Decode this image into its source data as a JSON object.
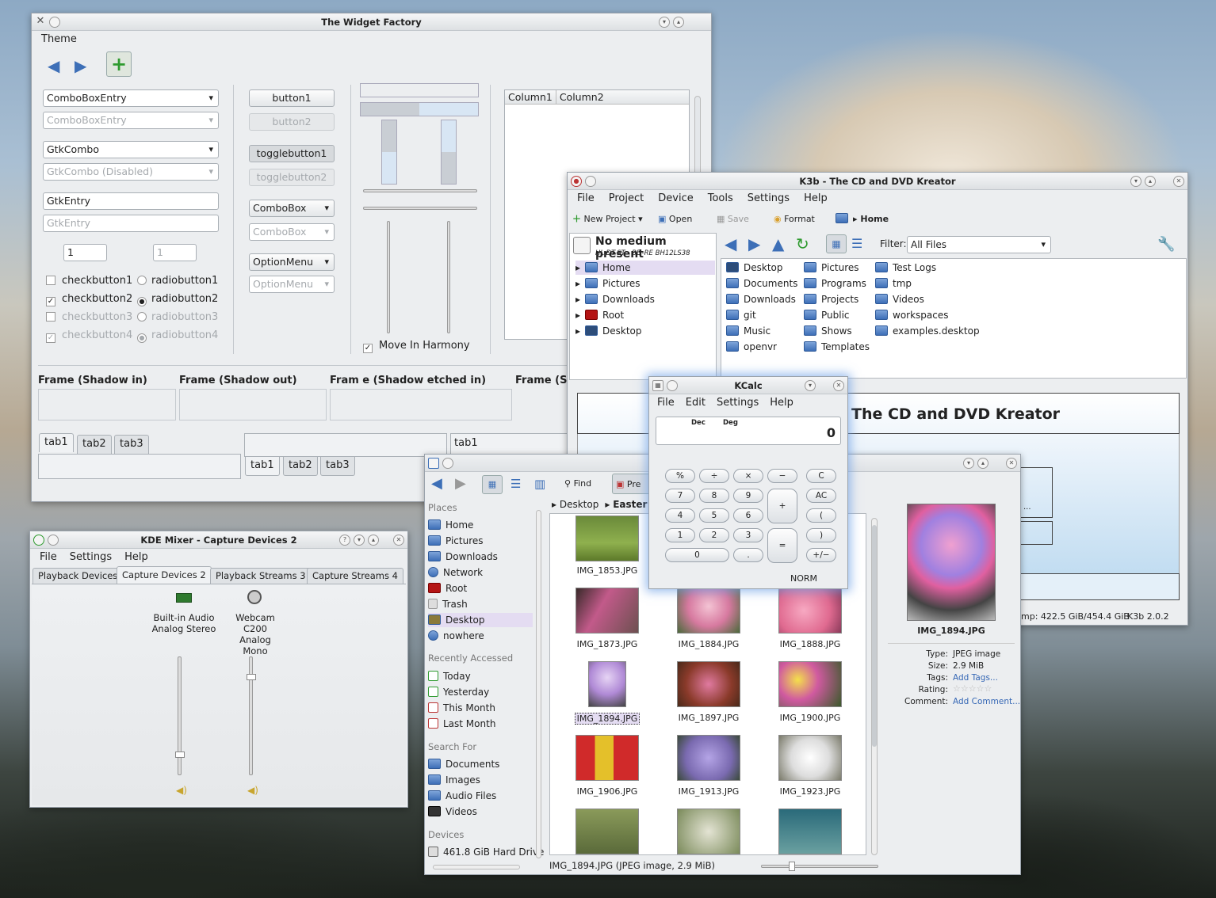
{
  "desktop": {
    "accent": "#3d6fb7"
  },
  "widget_factory": {
    "title": "The Widget Factory",
    "menu": [
      "Theme"
    ],
    "combo_entry": "ComboBoxEntry",
    "combo_entry_dis": "ComboBoxEntry",
    "gtk_combo": "GtkCombo",
    "gtk_combo_dis": "GtkCombo (Disabled)",
    "gtk_entry": "GtkEntry",
    "gtk_entry_dis": "GtkEntry",
    "spin1": "1",
    "spin2": "1",
    "checks": [
      "checkbutton1",
      "checkbutton2",
      "checkbutton3",
      "checkbutton4"
    ],
    "radios": [
      "radiobutton1",
      "radiobutton2",
      "radiobutton3",
      "radiobutton4"
    ],
    "buttons": [
      "button1",
      "button2",
      "togglebutton1",
      "togglebutton2",
      "ComboBox",
      "ComboBox",
      "OptionMenu",
      "OptionMenu"
    ],
    "move_harmony": "Move In Harmony",
    "columns": [
      "Column1",
      "Column2"
    ],
    "frames": [
      "Frame (Shadow in)",
      "Frame (Shadow out)",
      "Fram e (Shadow etched in)",
      "Frame (S"
    ],
    "tabs": [
      "tab1",
      "tab2",
      "tab3"
    ],
    "tab_partial": "tab1"
  },
  "mixer": {
    "title": "KDE Mixer - Capture Devices 2",
    "menu": [
      "File",
      "Settings",
      "Help"
    ],
    "tabs": [
      "Playback Devices",
      "Capture Devices 2",
      "Playback Streams 3",
      "Capture Streams 4"
    ],
    "dev1": "Built-in Audio Analog Stereo",
    "dev2": "Webcam C200 Analog Mono",
    "mute_level": 0.15,
    "webcam_level": 0.85
  },
  "k3b": {
    "title": "K3b - The CD and DVD Kreator",
    "menu": [
      "File",
      "Project",
      "Device",
      "Tools",
      "Settings",
      "Help"
    ],
    "toolbar": {
      "new_project": "New Project",
      "open": "Open",
      "save": "Save",
      "format": "Format",
      "home": "Home"
    },
    "medium": "No medium present",
    "drive": "HL-DT-ST - BD-RE  BH12LS38",
    "tree": [
      "Home",
      "Pictures",
      "Downloads",
      "Root",
      "Desktop"
    ],
    "filter_label": "Filter:",
    "filter_value": "All Files",
    "files": [
      [
        "Desktop",
        "Documents",
        "Downloads",
        "git",
        "Music",
        "openvr"
      ],
      [
        "Pictures",
        "Programs",
        "Projects",
        "Public",
        "Shows",
        "Templates"
      ],
      [
        "Test Logs",
        "tmp",
        "Videos",
        "workspaces",
        "examples.desktop"
      ]
    ],
    "banner": "The CD and DVD Kreator",
    "status_space": "mp: 422.5 GiB/454.4 GiB",
    "status_version": "K3b 2.0.2",
    "dots": "..."
  },
  "kcalc": {
    "title": "KCalc",
    "menu": [
      "File",
      "Edit",
      "Settings",
      "Help"
    ],
    "mode1": "Dec",
    "mode2": "Deg",
    "display": "0",
    "keys": [
      "%",
      "÷",
      "×",
      "−",
      "C",
      "7",
      "8",
      "9",
      "+",
      "AC",
      "4",
      "5",
      "6",
      "(",
      "1",
      "2",
      "3",
      "=",
      ")",
      "0",
      ".",
      "+/−"
    ],
    "status": "NORM"
  },
  "dolphin": {
    "toolbar": {
      "find": "Find",
      "preview": "Pre"
    },
    "places_h": "Places",
    "places": [
      "Home",
      "Pictures",
      "Downloads",
      "Network",
      "Root",
      "Trash",
      "Desktop",
      "nowhere"
    ],
    "recent_h": "Recently Accessed",
    "recent": [
      "Today",
      "Yesterday",
      "This Month",
      "Last Month"
    ],
    "search_h": "Search For",
    "search": [
      "Documents",
      "Images",
      "Audio Files",
      "Videos"
    ],
    "devices_h": "Devices",
    "devices": [
      "461.8 GiB Hard Drive"
    ],
    "breadcrumb": [
      "Desktop",
      "Easter"
    ],
    "images": [
      "IMG_1853.JPG",
      "IMG_1873.JPG",
      "IMG_1884.JPG",
      "IMG_1888.JPG",
      "IMG_1894.JPG",
      "IMG_1897.JPG",
      "IMG_1900.JPG",
      "IMG_1906.JPG",
      "IMG_1913.JPG",
      "IMG_1923.JPG"
    ],
    "preview_name": "IMG_1894.JPG",
    "info": {
      "type_l": "Type:",
      "type": "JPEG image",
      "size_l": "Size:",
      "size": "2.9 MiB",
      "tags_l": "Tags:",
      "tags": "Add Tags...",
      "rating_l": "Rating:",
      "comment_l": "Comment:",
      "comment": "Add Comment..."
    },
    "status": "IMG_1894.JPG (JPEG image, 2.9 MiB)"
  }
}
